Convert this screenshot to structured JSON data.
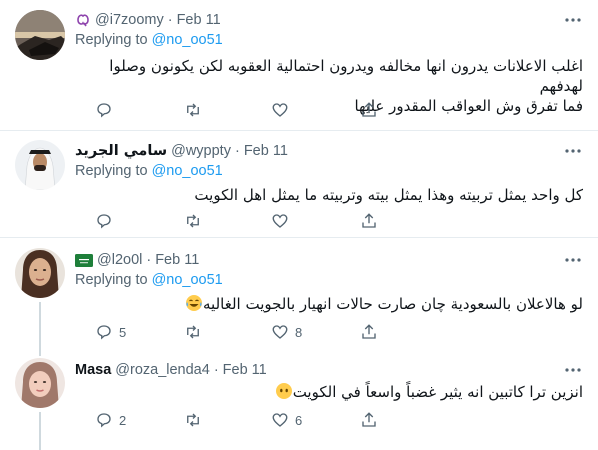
{
  "tweets": [
    {
      "name": "",
      "name_icon": "quote-glyph-icon",
      "handle": "@i7zoomy",
      "dot": "·",
      "date": "Feb 11",
      "replying_label": "Replying to",
      "replying_to": "@no_oo51",
      "text_line1": "اغلب الاعلانات يدرون انها مخالفه ويدرون احتمالية العقوبه لكن يكونون وصلوا لهدفهم",
      "text_line2": "فما تفرق وش العواقب المقدور عليها",
      "reply_count": "",
      "like_count": ""
    },
    {
      "name": "سامي الجريد",
      "handle": "@wyppty",
      "dot": "·",
      "date": "Feb 11",
      "replying_label": "Replying to",
      "replying_to": "@no_oo51",
      "text_line1": "كل واحد يمثل تربيته وهذا يمثل بيته وتربيته ما يمثل اهل الكويت",
      "reply_count": "",
      "like_count": ""
    },
    {
      "name": "",
      "name_icon": "saudi-flag-icon",
      "handle": "@l2o0l",
      "dot": "·",
      "date": "Feb 11",
      "replying_label": "Replying to",
      "replying_to": "@no_oo51",
      "text_line1": "لو هالاعلان بالسعودية چان صارت حالات انهيار بالجويت الغاليه",
      "emoji": "face-with-tears-of-joy-icon",
      "reply_count": "5",
      "like_count": "8"
    },
    {
      "name": "Masa",
      "handle": "@roza_lenda4",
      "dot": "·",
      "date": "Feb 11",
      "text_line1": "انزين ترا كاتبين انه يثير غضباً واسعاً في الكويت",
      "emoji": "face-without-mouth-icon",
      "reply_count": "2",
      "like_count": "6"
    }
  ],
  "colors": {
    "text": "#0f1419",
    "secondary": "#536471",
    "link": "#1d9bf0",
    "separator": "#e6ecf0",
    "thread_line": "#cfd9de"
  }
}
